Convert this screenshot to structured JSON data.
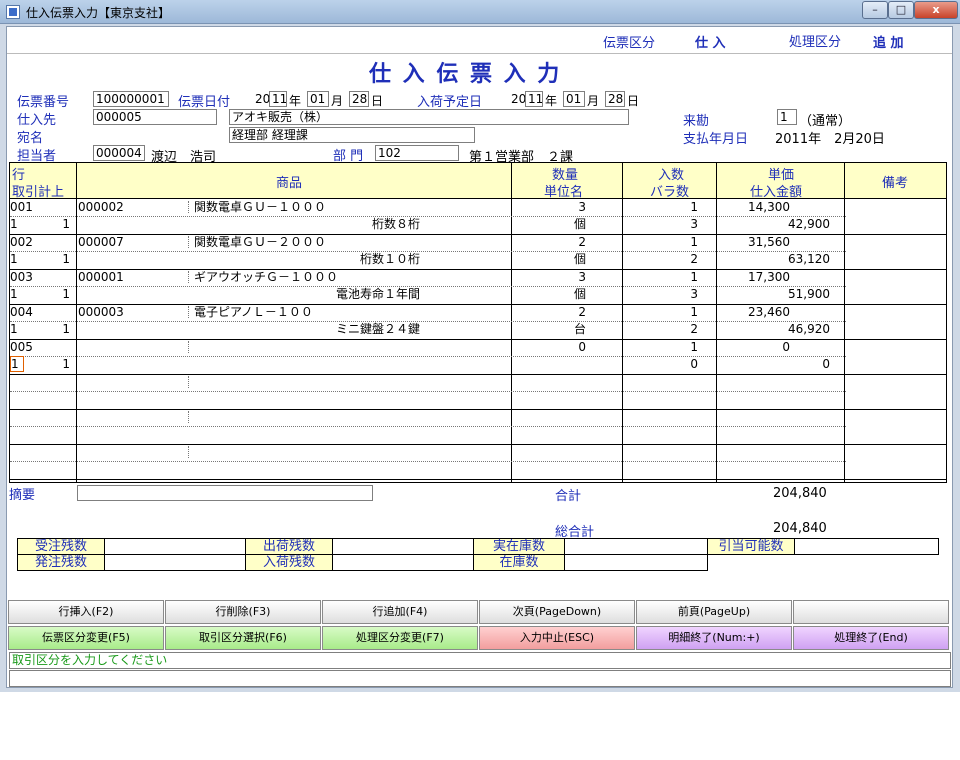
{
  "window": {
    "title": "仕入伝票入力【東京支社】",
    "min": "–",
    "max": "□",
    "close": "x"
  },
  "header": {
    "slip_type_label": "伝票区分",
    "slip_type_value": "仕 入",
    "process_type_label": "処理区分",
    "process_type_value": "追 加",
    "page_title": "仕 入 伝 票 入 力"
  },
  "form": {
    "slip_no_label": "伝票番号",
    "slip_no": "100000001",
    "slip_date_label": "伝票日付",
    "slip_date_y_prefix": "20",
    "slip_date_y": "11",
    "year_suffix": "年",
    "slip_date_m": "01",
    "month_suffix": "月",
    "slip_date_d": "28",
    "day_suffix": "日",
    "arrival_label": "入荷予定日",
    "arrival_y_prefix": "20",
    "arrival_y": "11",
    "arrival_m": "01",
    "arrival_d": "28",
    "supplier_label": "仕入先",
    "supplier_code": "000005",
    "supplier_name": "アオキ販売（株）",
    "attention_label": "宛名",
    "attention_value": "経理部 経理課",
    "rep_label": "担当者",
    "rep_code": "000004",
    "rep_name": "渡辺　浩司",
    "dept_label": "部 門",
    "dept_code": "102",
    "dept_name": "第１営業部　２課",
    "visit_label": "来勘",
    "visit_code": "1",
    "visit_text": "（通常）",
    "payment_label": "支払年月日",
    "payment_value": "2011年　2月20日"
  },
  "grid": {
    "headers": {
      "row1": "行",
      "row2": "取引計上",
      "item": "商品",
      "qty1": "数量",
      "qty2": "単位名",
      "pack1": "入数",
      "pack2": "バラ数",
      "price1": "単価",
      "price2": "仕入金額",
      "note": "備考"
    },
    "rows": [
      {
        "line": "001",
        "t1": "1",
        "t2": "1",
        "code": "000002",
        "name": "関数電卓ＧＵ－１０００",
        "spec": "桁数８桁",
        "qty": "3",
        "unit": "個",
        "pack": "1",
        "bara": "3",
        "price": "14,300",
        "amount": "42,900"
      },
      {
        "line": "002",
        "t1": "1",
        "t2": "1",
        "code": "000007",
        "name": "関数電卓ＧＵ－２０００",
        "spec": "桁数１０桁",
        "qty": "2",
        "unit": "個",
        "pack": "1",
        "bara": "2",
        "price": "31,560",
        "amount": "63,120"
      },
      {
        "line": "003",
        "t1": "1",
        "t2": "1",
        "code": "000001",
        "name": "ギアウオッチＧ－１０００",
        "spec": "電池寿命１年間",
        "qty": "3",
        "unit": "個",
        "pack": "1",
        "bara": "3",
        "price": "17,300",
        "amount": "51,900"
      },
      {
        "line": "004",
        "t1": "1",
        "t2": "1",
        "code": "000003",
        "name": "電子ピアノＬ－１００",
        "spec": "ミニ鍵盤２４鍵",
        "qty": "2",
        "unit": "台",
        "pack": "1",
        "bara": "2",
        "price": "23,460",
        "amount": "46,920"
      },
      {
        "line": "005",
        "t1": "1",
        "t2": "1",
        "code": "",
        "name": "",
        "spec": "",
        "qty": "0",
        "unit": "",
        "pack": "1",
        "bara": "0",
        "price": "0",
        "amount": "0"
      }
    ]
  },
  "summary": {
    "memo_label": "摘要",
    "memo_value": "",
    "total_label": "合計",
    "total_value": "204,840",
    "grand_total_label": "総合計",
    "grand_total_value": "204,840",
    "order_remain": "受注残数",
    "ship_remain": "出荷残数",
    "actual_stock": "実在庫数",
    "allocatable": "引当可能数",
    "po_remain": "発注残数",
    "recv_remain": "入荷残数",
    "stock": "在庫数"
  },
  "buttons": {
    "row1": [
      "行挿入(F2)",
      "行削除(F3)",
      "行追加(F4)",
      "次頁(PageDown)",
      "前頁(PageUp)",
      ""
    ],
    "row2": [
      "伝票区分変更(F5)",
      "取引区分選択(F6)",
      "処理区分変更(F7)",
      "入力中止(ESC)",
      "明細終了(Num:+)",
      "処理終了(End)"
    ]
  },
  "status": {
    "message": "取引区分を入力してください",
    "message2": ""
  },
  "colors": {
    "header_bg": "#ffffc8",
    "label_blue": "#1f2fb8",
    "button_green": "#a8eb8a",
    "button_red": "#f29e9e",
    "button_purple": "#cfa1f2"
  }
}
